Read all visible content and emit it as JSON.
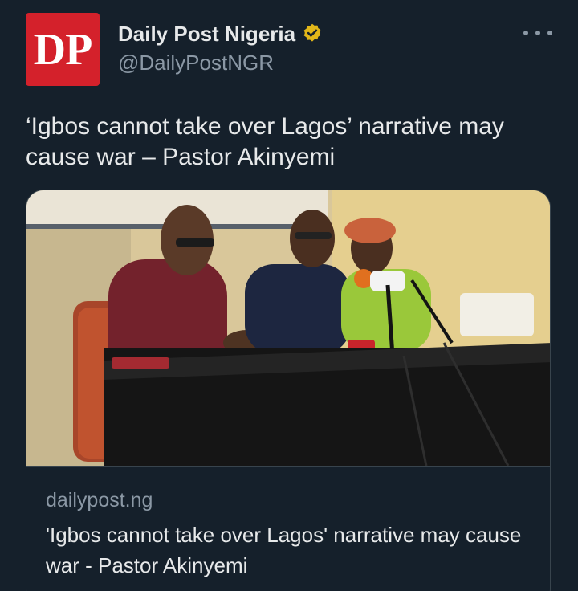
{
  "author": {
    "avatar_text": "DP",
    "display_name": "Daily Post Nigeria",
    "handle": "@DailyPostNGR",
    "verified": true,
    "verified_badge_color": "#e2b719"
  },
  "tweet": {
    "text": "‘Igbos cannot take over Lagos’ narrative may cause war – Pastor Akinyemi"
  },
  "link_card": {
    "domain": "dailypost.ng",
    "title": "'Igbos cannot take over Lagos' narrative may cause war - Pastor Akinyemi"
  },
  "colors": {
    "background": "#15202b",
    "primary_text": "#e7e9ea",
    "secondary_text": "#8b98a5",
    "border": "#38444d",
    "avatar_red": "#d4212b"
  },
  "icons": {
    "more": "more-horizontal-icon",
    "verified": "verified-badge-icon"
  }
}
